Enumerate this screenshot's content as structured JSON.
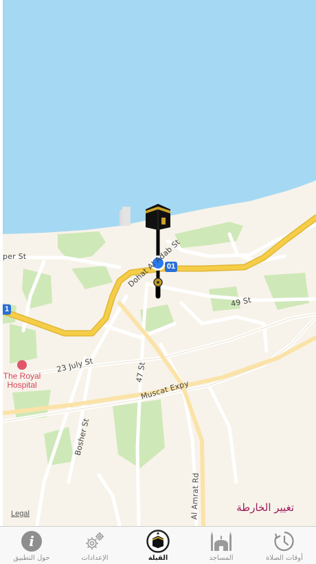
{
  "map": {
    "legal_link": "Legal",
    "change_map_label": "تغيير الخارطة",
    "route_shields": [
      "01",
      "1"
    ],
    "streets": [
      "per St",
      "Dohat Al Adab St",
      "49 St",
      "23 July St",
      "47 St",
      "Muscat Expy",
      "Bosher St",
      "Al Amrat Rd"
    ],
    "poi": {
      "name_line1": "The Royal",
      "name_line2": "Hospital"
    }
  },
  "tabs": [
    {
      "id": "about",
      "label": "حول التطبيق",
      "icon": "info-icon",
      "active": false
    },
    {
      "id": "settings",
      "label": "الإعدادات",
      "icon": "gear-icon",
      "active": false
    },
    {
      "id": "qibla",
      "label": "القبلة",
      "icon": "kaaba-icon",
      "active": true
    },
    {
      "id": "mosques",
      "label": "المساجد",
      "icon": "mosque-icon",
      "active": false
    },
    {
      "id": "prayer_times",
      "label": "أوقات الصلاة",
      "icon": "clock-icon",
      "active": false
    }
  ],
  "colors": {
    "sea": "#a5d8f3",
    "land": "#f7f3ea",
    "park": "#cfe8b8",
    "major_road": "#f2c744",
    "minor_road": "#ffffff",
    "location_dot": "#2a7bf0",
    "change_map_text": "#9e1a5a"
  }
}
